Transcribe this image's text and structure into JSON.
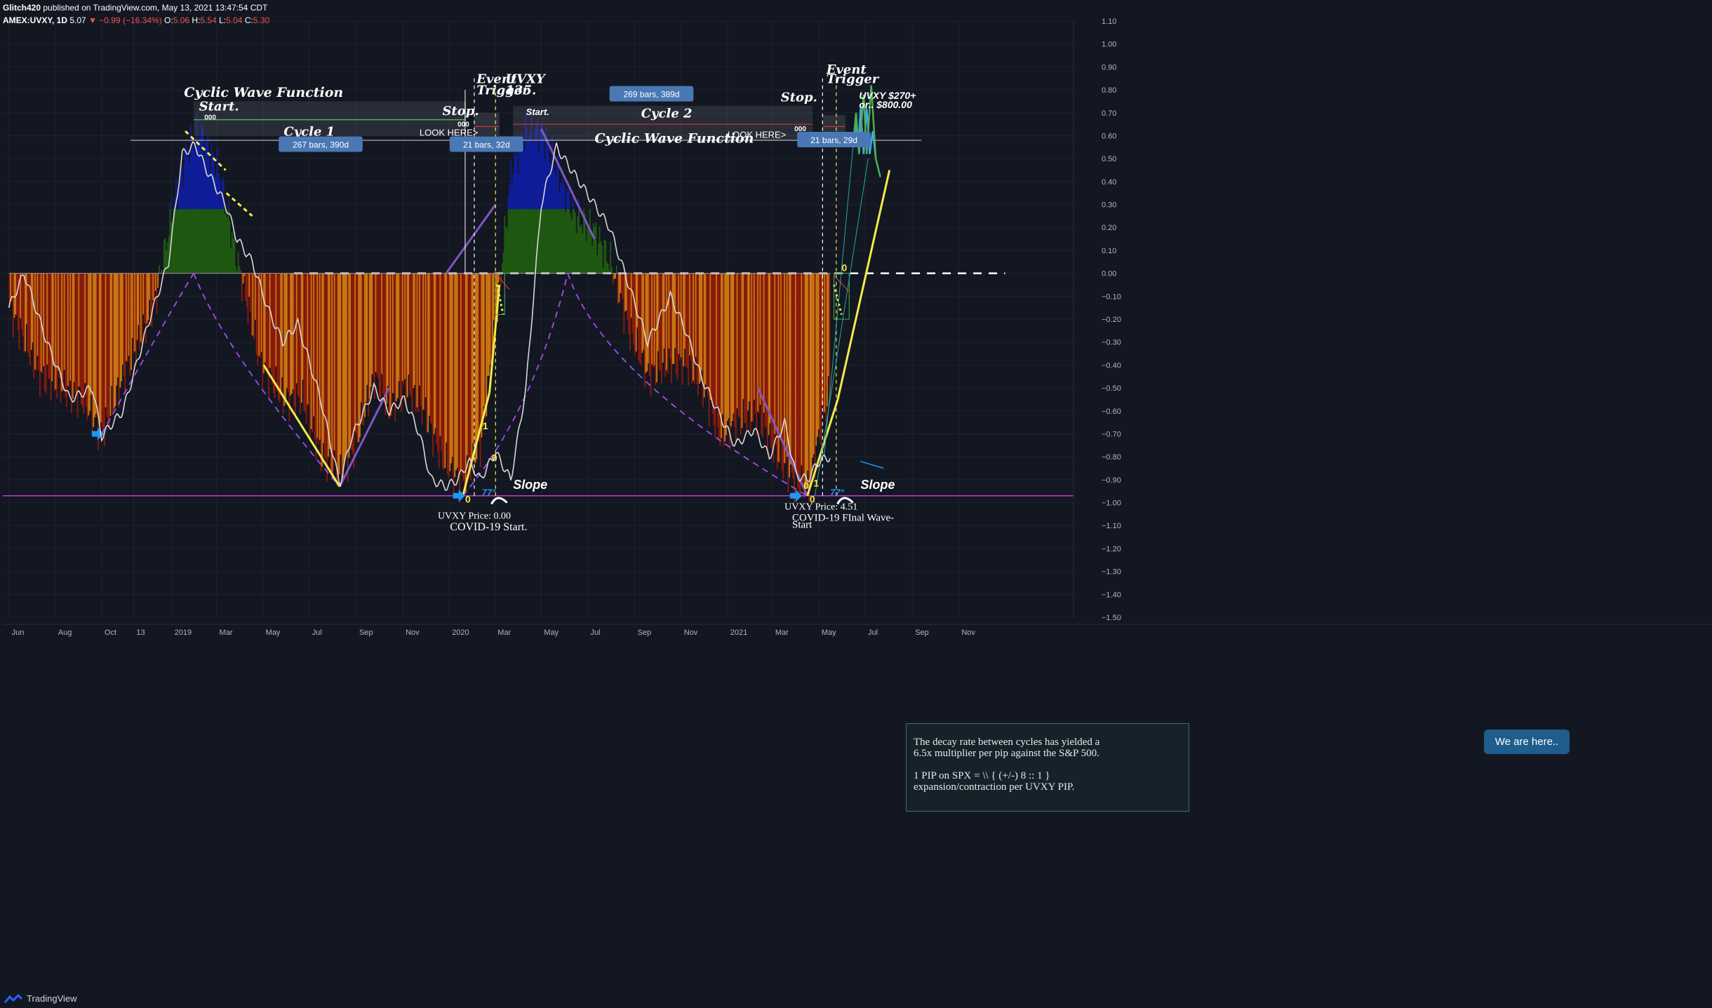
{
  "header": {
    "author": "Glitch420",
    "published": "published on TradingView.com, May 13, 2021 13:47:54 CDT",
    "symbol": "AMEX:UVXY, 1D",
    "last": "5.07",
    "change": "▼ −0.99 (−16.34%)",
    "o_label": "O:",
    "o": "5.06",
    "h_label": "H:",
    "h": "5.54",
    "l_label": "L:",
    "l": "5.04",
    "c_label": "C:",
    "c": "5.30"
  },
  "footer": {
    "brand": "TradingView"
  },
  "colors": {
    "background": "#131722",
    "red_bar": "#8b1a0c",
    "orange_bar": "#c97a12",
    "green_bar": "#1f5a10",
    "blue_bar": "#0f1d9c",
    "yellow": "#f5ea4a",
    "purple": "#7e57c2",
    "magenta_line": "#c03ad6",
    "white_line": "#d8d8d8"
  },
  "chart_data": {
    "type": "bar",
    "ylim": [
      -1.5,
      1.1
    ],
    "y_ticks": [
      "1.10",
      "1.00",
      "0.90",
      "0.80",
      "0.70",
      "0.60",
      "0.50",
      "0.40",
      "0.30",
      "0.20",
      "0.10",
      "0.00",
      "−0.10",
      "−0.20",
      "−0.30",
      "−0.40",
      "−0.50",
      "−0.60",
      "−0.70",
      "−0.80",
      "−0.90",
      "−1.00",
      "−1.10",
      "−1.20",
      "−1.30",
      "−1.40",
      "−1.50"
    ],
    "y_tick_values": [
      1.1,
      1.0,
      0.9,
      0.8,
      0.7,
      0.6,
      0.5,
      0.4,
      0.3,
      0.2,
      0.1,
      0.0,
      -0.1,
      -0.2,
      -0.3,
      -0.4,
      -0.5,
      -0.6,
      -0.7,
      -0.8,
      -0.9,
      -1.0,
      -1.1,
      -1.2,
      -1.3,
      -1.4,
      -1.5
    ],
    "x_ticks": [
      "Jun",
      "Aug",
      "Oct",
      "13",
      "2019",
      "Mar",
      "May",
      "Jul",
      "Sep",
      "Nov",
      "2020",
      "Mar",
      "May",
      "Jul",
      "Sep",
      "Nov",
      "2021",
      "Mar",
      "May",
      "Jul",
      "Sep",
      "Nov"
    ],
    "x_tick_days": [
      0,
      61,
      122,
      164,
      214,
      273,
      334,
      395,
      457,
      518,
      579,
      639,
      700,
      761,
      823,
      884,
      945,
      1004,
      1065,
      1126,
      1188,
      1249
    ],
    "x_range_days": [
      -8,
      1400
    ],
    "oscillator_keypoints": [
      [
        0,
        -0.15
      ],
      [
        40,
        -0.45
      ],
      [
        95,
        -0.55
      ],
      [
        122,
        -0.7
      ],
      [
        150,
        -0.45
      ],
      [
        190,
        -0.15
      ],
      [
        210,
        0.2
      ],
      [
        232,
        0.52
      ],
      [
        250,
        0.62
      ],
      [
        275,
        0.45
      ],
      [
        300,
        0.05
      ],
      [
        330,
        -0.4
      ],
      [
        360,
        -0.55
      ],
      [
        385,
        -0.55
      ],
      [
        410,
        -0.8
      ],
      [
        435,
        -0.88
      ],
      [
        455,
        -0.75
      ],
      [
        480,
        -0.45
      ],
      [
        500,
        -0.6
      ],
      [
        520,
        -0.5
      ],
      [
        545,
        -0.6
      ],
      [
        570,
        -0.82
      ],
      [
        597,
        -0.92
      ],
      [
        620,
        -0.75
      ],
      [
        640,
        -0.2
      ],
      [
        660,
        0.45
      ],
      [
        680,
        0.62
      ],
      [
        700,
        0.62
      ],
      [
        720,
        0.45
      ],
      [
        745,
        0.25
      ],
      [
        770,
        0.18
      ],
      [
        790,
        0.05
      ],
      [
        815,
        -0.25
      ],
      [
        840,
        -0.45
      ],
      [
        865,
        -0.4
      ],
      [
        890,
        -0.4
      ],
      [
        915,
        -0.52
      ],
      [
        935,
        -0.72
      ],
      [
        955,
        -0.65
      ],
      [
        985,
        -0.62
      ],
      [
        1010,
        -0.8
      ],
      [
        1035,
        -0.92
      ],
      [
        1050,
        -0.95
      ],
      [
        1065,
        -0.7
      ],
      [
        1080,
        -0.5
      ]
    ],
    "white_line_keypoints": [
      [
        0,
        -0.15
      ],
      [
        20,
        0.0
      ],
      [
        50,
        -0.3
      ],
      [
        80,
        -0.55
      ],
      [
        110,
        -0.5
      ],
      [
        122,
        -0.71
      ],
      [
        150,
        -0.6
      ],
      [
        185,
        -0.2
      ],
      [
        210,
        0.05
      ],
      [
        228,
        0.52
      ],
      [
        245,
        0.56
      ],
      [
        260,
        0.45
      ],
      [
        285,
        0.3
      ],
      [
        300,
        0.15
      ],
      [
        320,
        0.05
      ],
      [
        340,
        -0.15
      ],
      [
        360,
        -0.3
      ],
      [
        380,
        -0.22
      ],
      [
        410,
        -0.55
      ],
      [
        435,
        -0.92
      ],
      [
        450,
        -0.72
      ],
      [
        470,
        -0.58
      ],
      [
        480,
        -0.5
      ],
      [
        500,
        -0.6
      ],
      [
        520,
        -0.55
      ],
      [
        540,
        -0.7
      ],
      [
        555,
        -0.9
      ],
      [
        575,
        -0.93
      ],
      [
        590,
        -0.9
      ],
      [
        605,
        -0.82
      ],
      [
        620,
        -0.9
      ],
      [
        640,
        -0.78
      ],
      [
        660,
        -0.9
      ],
      [
        680,
        -0.5
      ],
      [
        700,
        0.3
      ],
      [
        720,
        0.55
      ],
      [
        740,
        0.45
      ],
      [
        760,
        0.35
      ],
      [
        790,
        0.2
      ],
      [
        815,
        -0.05
      ],
      [
        840,
        -0.3
      ],
      [
        870,
        -0.1
      ],
      [
        890,
        -0.25
      ],
      [
        910,
        -0.45
      ],
      [
        935,
        -0.62
      ],
      [
        955,
        -0.75
      ],
      [
        980,
        -0.68
      ],
      [
        1000,
        -0.8
      ],
      [
        1020,
        -0.65
      ],
      [
        1035,
        -0.88
      ],
      [
        1050,
        -0.9
      ],
      [
        1065,
        -0.82
      ],
      [
        1080,
        -0.8
      ]
    ],
    "annotations": {
      "cyclic_wave_1": "Cyclic Wave Function",
      "cyclic_wave_2": "Cyclic Wave Function",
      "start_1": "Start.",
      "stop_1": "Stop.",
      "cycle_1": "Cycle 1",
      "look_here_1": "LOOK HERE>",
      "bars_1": "267 bars, 390d",
      "zeros_1a": "000",
      "zeros_1b": "000",
      "event_trigger_1a": "Event",
      "event_trigger_1b": "Trigger",
      "bars_1b": "21 bars, 32d",
      "uvxy_135a": "UVXY",
      "uvxy_135b": "135.",
      "start_2": "Start.",
      "cycle_2": "Cycle 2",
      "stop_2": "Stop.",
      "look_here_2": "LOOK HERE>",
      "bars_2": "269 bars, 389d",
      "zeros_2": "000",
      "event_trigger_2a": "Event",
      "event_trigger_2b": "Trigger",
      "bars_2b": "21 bars, 29d",
      "target_a": "UVXY $270+",
      "target_b": "or.. $800.00",
      "slope_1": "Slope",
      "slope_2": "Slope",
      "angle_1": "77°",
      "angle_2": "77°",
      "uvxy_price_1": "UVXY Price: 0.00",
      "covid_start": "COVID-19 Start.",
      "uvxy_price_2": "UVXY Price: 4.51",
      "covid_final_a": "COVID-19 FInal Wave-",
      "covid_final_b": "Start",
      "wave_0_a": "0",
      "wave_1_a": "1",
      "wave_0_b": "0",
      "wave_0_c": "0",
      "wave_1_c": "1",
      "wave_0_d": "0",
      "wave_0_e": "0"
    }
  },
  "note": {
    "line1": "The decay rate between cycles has yielded a",
    "line2": "6.5x multiplier per pip against the S&P 500.",
    "line3": "1 PIP on SPX = \\\\  { (+/-)  8 :: 1 }",
    "line4": "expansion/contraction per UVXY PIP."
  },
  "bubble": "We are here.."
}
